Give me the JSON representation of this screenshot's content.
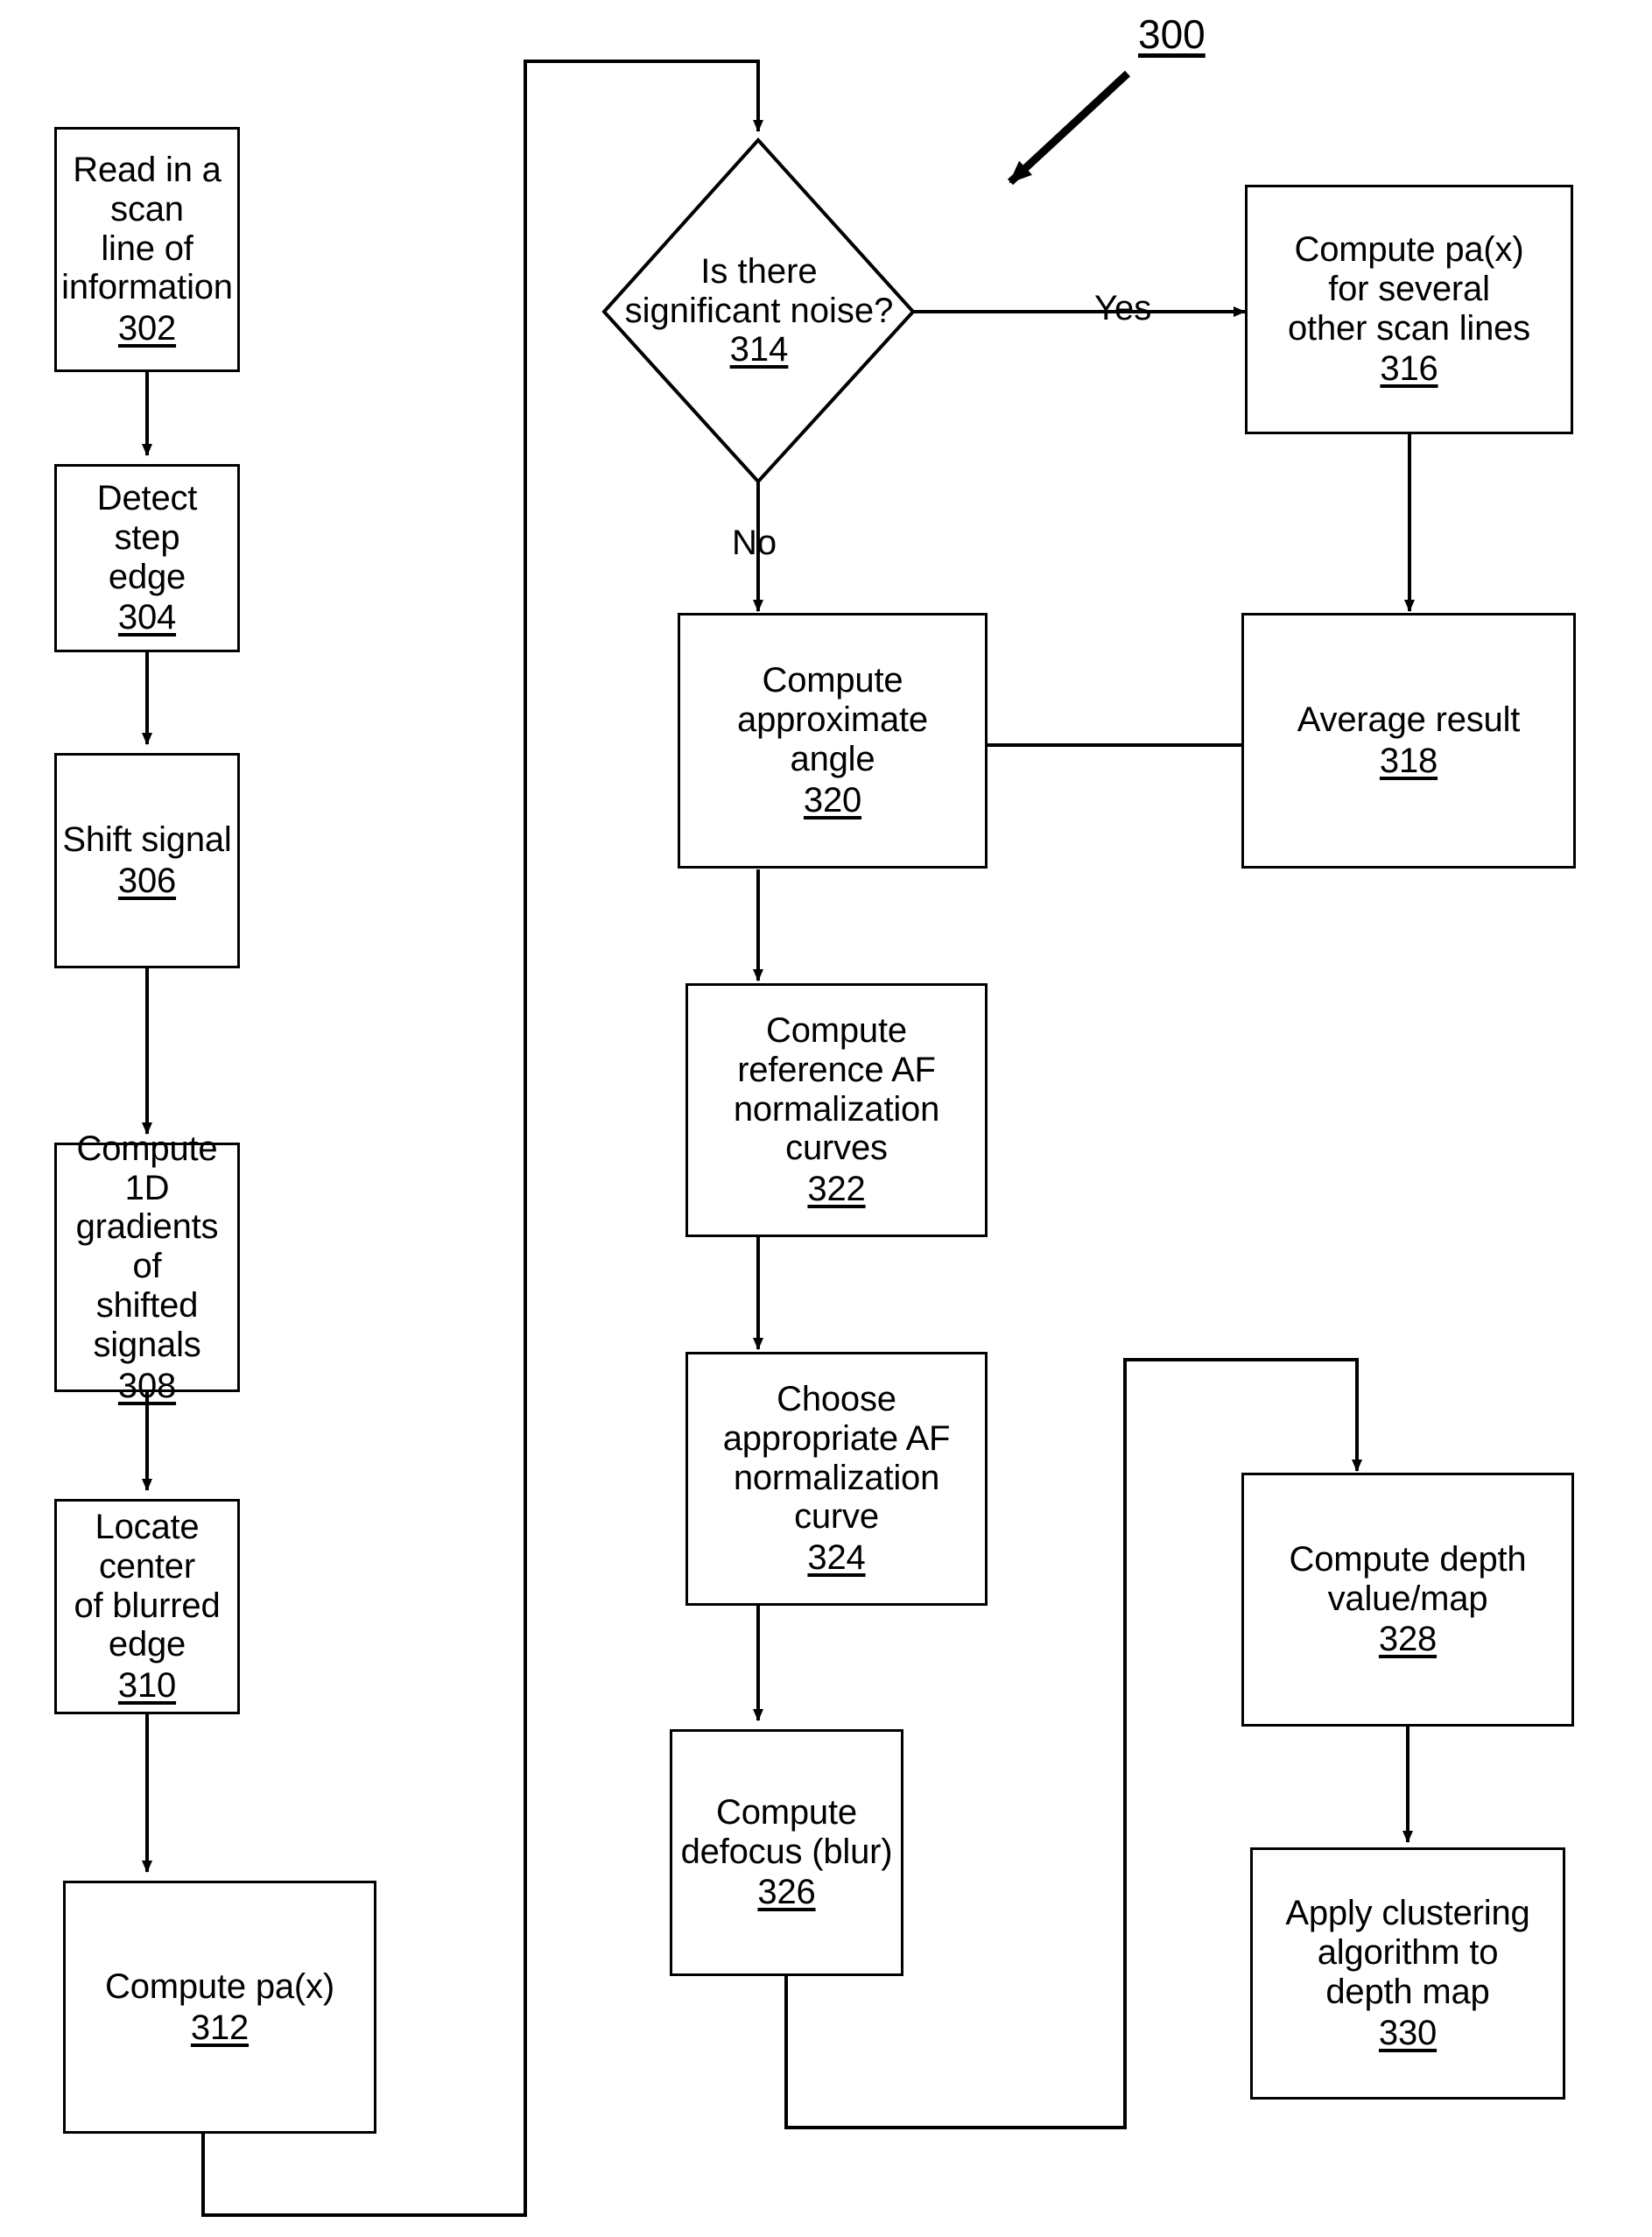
{
  "figure": {
    "reference_label": "300"
  },
  "nodes": [
    {
      "id": "n302",
      "shape": "process",
      "text": "Read in a scan\nline of\ninformation",
      "ref": "302"
    },
    {
      "id": "n304",
      "shape": "process",
      "text": "Detect step\nedge",
      "ref": "304"
    },
    {
      "id": "n306",
      "shape": "process",
      "text": "Shift signal",
      "ref": "306"
    },
    {
      "id": "n308",
      "shape": "process",
      "text": "Compute 1D\ngradients of\nshifted signals",
      "ref": "308"
    },
    {
      "id": "n310",
      "shape": "process",
      "text": "Locate center\nof blurred edge",
      "ref": "310"
    },
    {
      "id": "n312",
      "shape": "process",
      "text": "Compute pa(x)",
      "ref": "312"
    },
    {
      "id": "n314",
      "shape": "decision",
      "text": "Is there\nsignificant noise?",
      "ref": "314"
    },
    {
      "id": "n316",
      "shape": "process",
      "text": "Compute pa(x)\nfor several\nother scan lines",
      "ref": "316"
    },
    {
      "id": "n318",
      "shape": "process",
      "text": "Average result",
      "ref": "318"
    },
    {
      "id": "n320",
      "shape": "process",
      "text": "Compute\napproximate\nangle",
      "ref": "320"
    },
    {
      "id": "n322",
      "shape": "process",
      "text": "Compute\nreference AF\nnormalization\ncurves",
      "ref": "322"
    },
    {
      "id": "n324",
      "shape": "process",
      "text": "Choose\nappropriate AF\nnormalization\ncurve",
      "ref": "324"
    },
    {
      "id": "n326",
      "shape": "process",
      "text": "Compute\ndefocus (blur)",
      "ref": "326"
    },
    {
      "id": "n328",
      "shape": "process",
      "text": "Compute depth\nvalue/map",
      "ref": "328"
    },
    {
      "id": "n330",
      "shape": "process",
      "text": "Apply clustering\nalgorithm to\ndepth map",
      "ref": "330"
    }
  ],
  "edge_labels": {
    "yes": "Yes",
    "no": "No"
  },
  "colors": {
    "stroke": "#000000",
    "fill": "#ffffff",
    "text": "#000000"
  }
}
